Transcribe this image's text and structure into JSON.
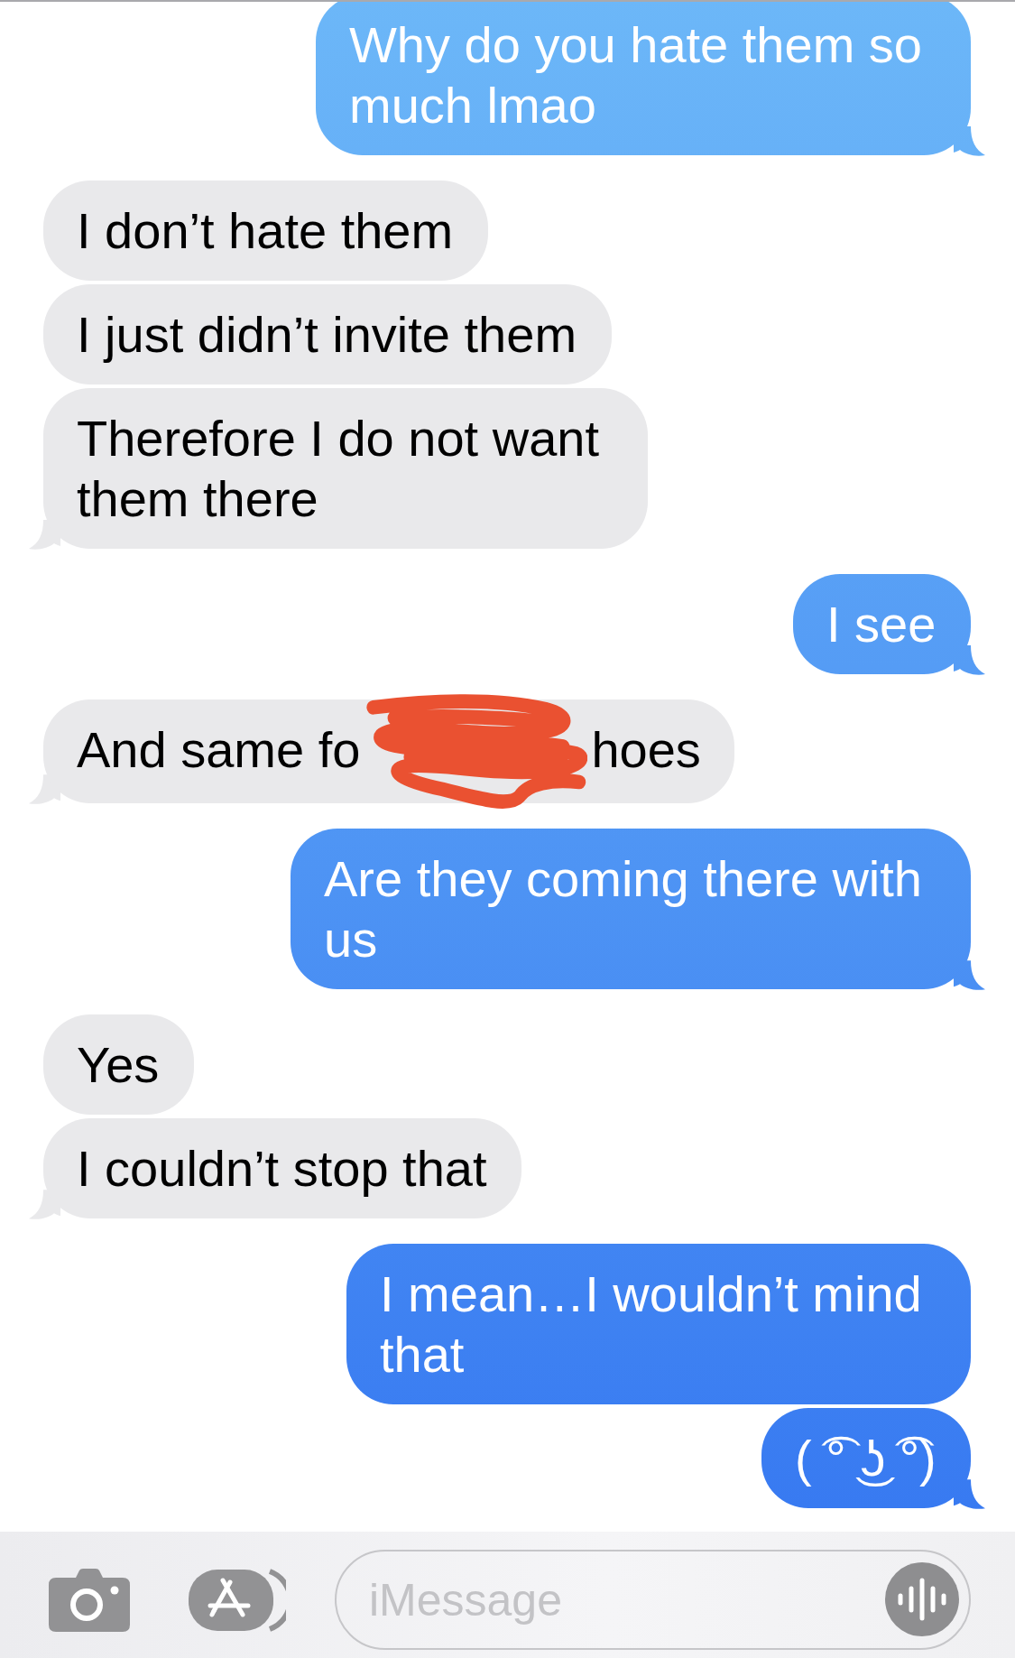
{
  "messages": [
    {
      "outgoing": true,
      "kind": "text",
      "text": "Why do you hate them so much lmao",
      "tail": true
    },
    {
      "outgoing": false,
      "kind": "text",
      "text": "I don’t hate them",
      "tail": false
    },
    {
      "outgoing": false,
      "kind": "text",
      "text": "I just didn’t invite them",
      "tail": false
    },
    {
      "outgoing": false,
      "kind": "text",
      "text": "Therefore I do not want them there",
      "tail": true
    },
    {
      "outgoing": true,
      "kind": "text",
      "text": "I see",
      "tail": true
    },
    {
      "outgoing": false,
      "kind": "scribbled",
      "visible_start": "And same fo",
      "visible_end": "hoes",
      "tail": true
    },
    {
      "outgoing": true,
      "kind": "text",
      "text": "Are they coming there with us",
      "tail": true
    },
    {
      "outgoing": false,
      "kind": "text",
      "text": "Yes",
      "tail": false
    },
    {
      "outgoing": false,
      "kind": "text",
      "text": "I couldn’t stop that",
      "tail": true
    },
    {
      "outgoing": true,
      "kind": "text",
      "text": "I mean…I wouldn’t mind that",
      "tail": false
    },
    {
      "outgoing": true,
      "kind": "text",
      "text": "( ͡° ͜ʖ ͡°)",
      "tail": true
    }
  ],
  "composer": {
    "placeholder": "iMessage"
  }
}
